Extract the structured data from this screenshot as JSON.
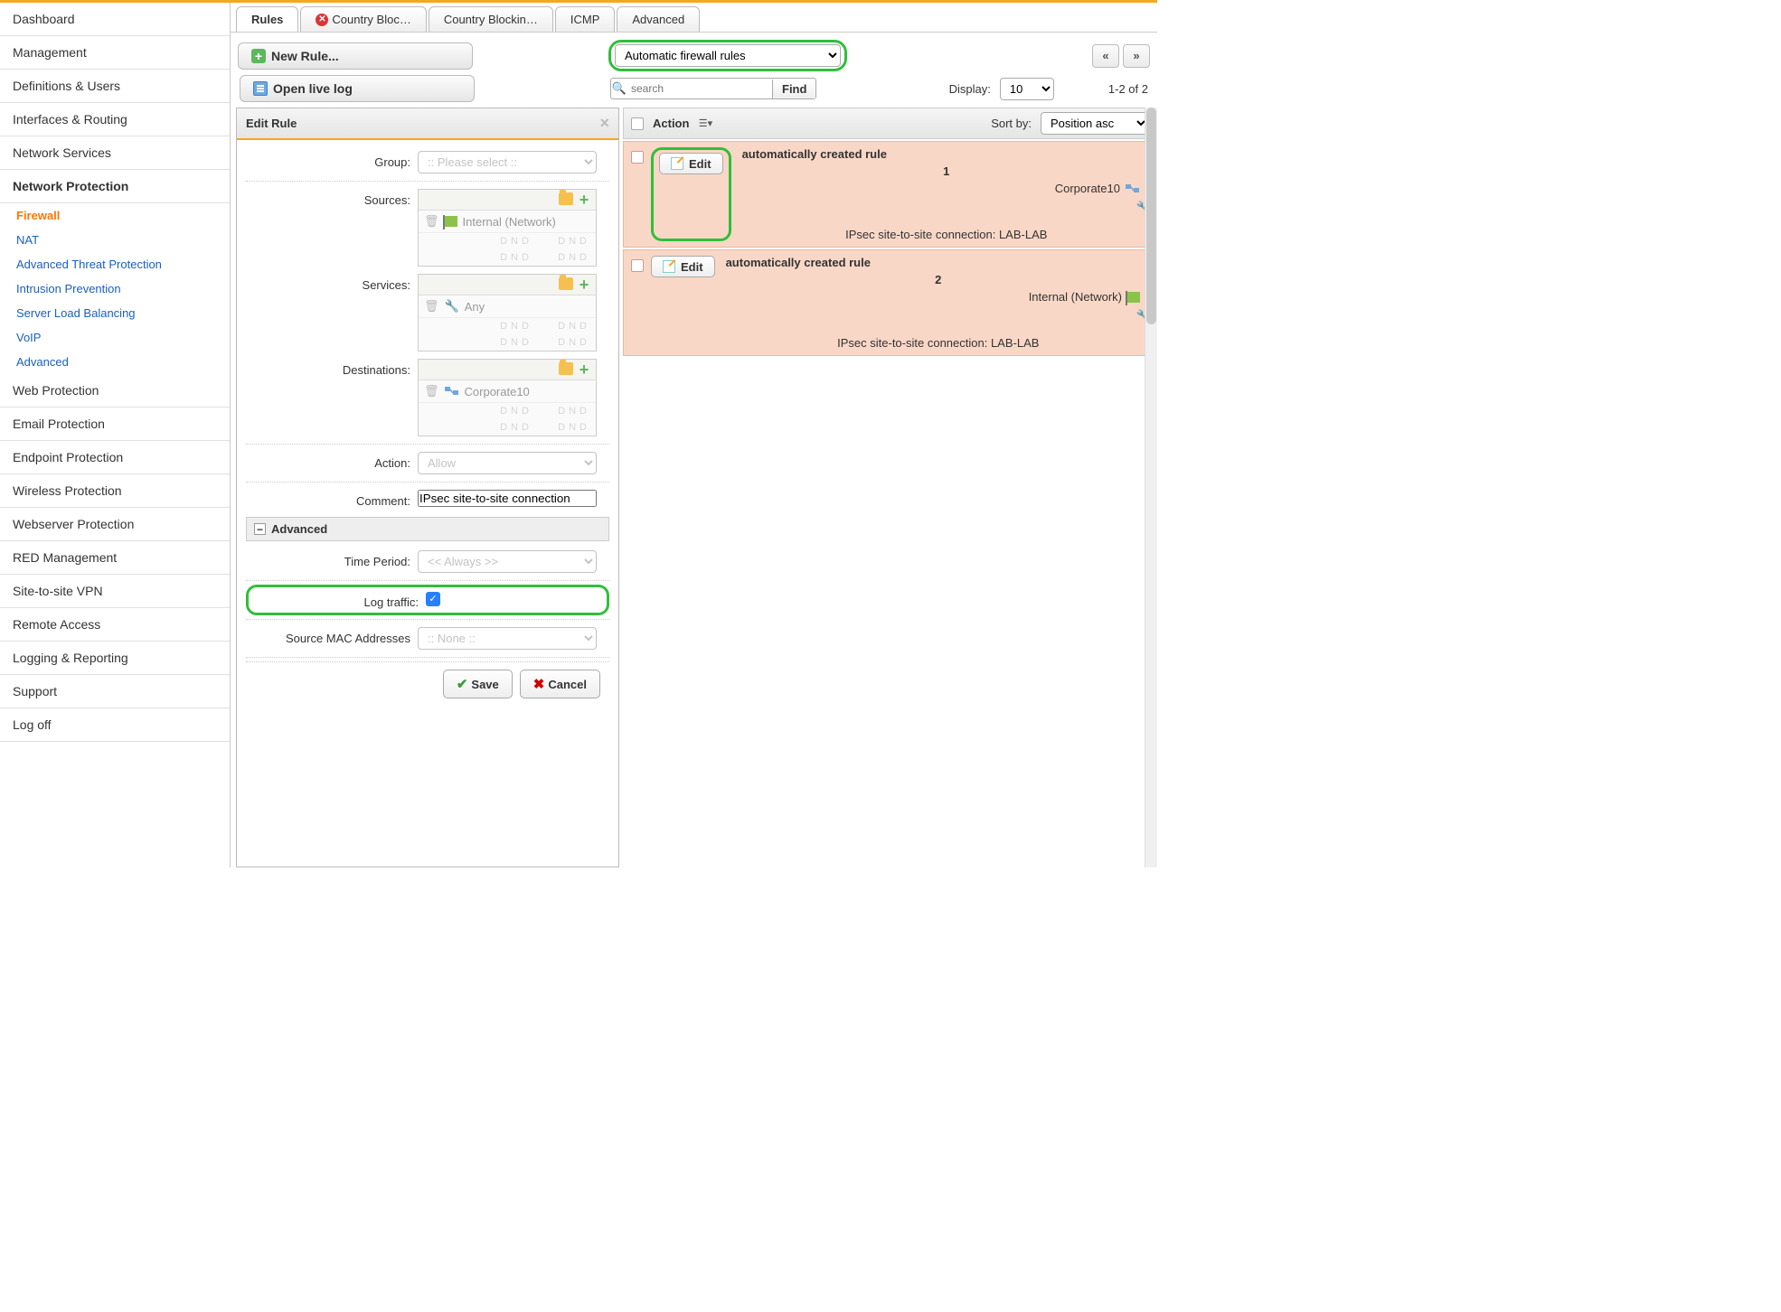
{
  "sidebar": {
    "items": [
      "Dashboard",
      "Management",
      "Definitions & Users",
      "Interfaces & Routing",
      "Network Services",
      "Network Protection",
      "Web Protection",
      "Email Protection",
      "Endpoint Protection",
      "Wireless Protection",
      "Webserver Protection",
      "RED Management",
      "Site-to-site VPN",
      "Remote Access",
      "Logging & Reporting",
      "Support",
      "Log off"
    ],
    "active_section": "Network Protection",
    "sub": [
      "Firewall",
      "NAT",
      "Advanced Threat Protection",
      "Intrusion Prevention",
      "Server Load Balancing",
      "VoIP",
      "Advanced"
    ],
    "sub_active": "Firewall"
  },
  "tabs": {
    "items": [
      "Rules",
      "Country Bloc…",
      "Country Blockin…",
      "ICMP",
      "Advanced"
    ],
    "active": "Rules"
  },
  "toolbar": {
    "new_rule": "New Rule...",
    "open_log": "Open live log",
    "filter_select": "Automatic firewall rules",
    "search_placeholder": "search",
    "find": "Find",
    "display_label": "Display:",
    "display_value": "10",
    "count": "1-2 of 2"
  },
  "editpanel": {
    "title": "Edit Rule",
    "labels": {
      "group": "Group:",
      "sources": "Sources:",
      "services": "Services:",
      "destinations": "Destinations:",
      "action": "Action:",
      "comment": "Comment:",
      "advanced": "Advanced",
      "time_period": "Time Period:",
      "log_traffic": "Log traffic:",
      "source_mac": "Source MAC Addresses"
    },
    "group_placeholder": ":: Please select ::",
    "sources_item": "Internal (Network)",
    "services_item": "Any",
    "destinations_item": "Corporate10",
    "dnd": "DND",
    "action_value": "Allow",
    "comment_value": "IPsec site-to-site connection",
    "time_value": "<< Always >>",
    "mac_value": ":: None ::",
    "save": "Save",
    "cancel": "Cancel"
  },
  "listpanel": {
    "action_col": "Action",
    "sort_label": "Sort by:",
    "sort_value": "Position asc",
    "edit_label": "Edit",
    "rules": [
      {
        "title": "automatically created rule",
        "num": "1",
        "obj": "Corporate10",
        "conn": "IPsec site-to-site connection: LAB-LAB",
        "obj_icon": "net"
      },
      {
        "title": "automatically created rule",
        "num": "2",
        "obj": "Internal (Network)",
        "conn": "IPsec site-to-site connection: LAB-LAB",
        "obj_icon": "flag"
      }
    ]
  }
}
